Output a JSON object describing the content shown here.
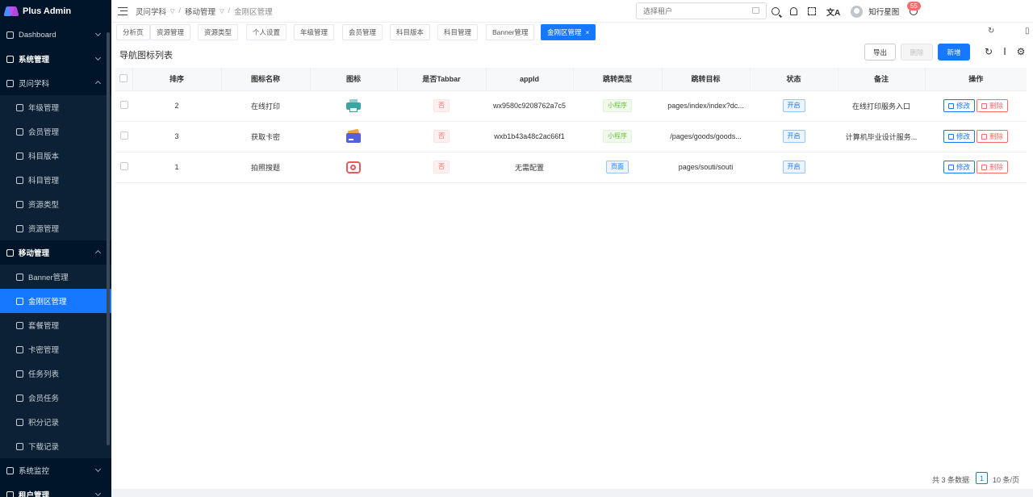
{
  "app": {
    "name": "Plus Admin"
  },
  "sidebar": {
    "items": [
      {
        "label": "Dashboard",
        "type": "top"
      },
      {
        "label": "系统管理",
        "type": "top-bold"
      },
      {
        "label": "灵问学科",
        "type": "top"
      },
      {
        "label": "年级管理",
        "type": "sub"
      },
      {
        "label": "会员管理",
        "type": "sub"
      },
      {
        "label": "科目版本",
        "type": "sub"
      },
      {
        "label": "科目管理",
        "type": "sub"
      },
      {
        "label": "资源类型",
        "type": "sub"
      },
      {
        "label": "资源管理",
        "type": "sub"
      },
      {
        "label": "移动管理",
        "type": "top-bold"
      },
      {
        "label": "Banner管理",
        "type": "sub"
      },
      {
        "label": "金刚区管理",
        "type": "sub-active"
      },
      {
        "label": "套餐管理",
        "type": "sub"
      },
      {
        "label": "卡密管理",
        "type": "sub"
      },
      {
        "label": "任务列表",
        "type": "sub"
      },
      {
        "label": "会员任务",
        "type": "sub"
      },
      {
        "label": "积分记录",
        "type": "sub"
      },
      {
        "label": "下载记录",
        "type": "sub"
      },
      {
        "label": "系统监控",
        "type": "top"
      },
      {
        "label": "租户管理",
        "type": "top-bold"
      }
    ]
  },
  "header": {
    "breadcrumb": [
      "灵问学科",
      "移动管理",
      "金刚区管理"
    ],
    "tenant_placeholder": "选择租户",
    "notification_count": "55",
    "username": "知行星图"
  },
  "tabs": [
    "分析页",
    "资源管理",
    "资源类型",
    "个人设置",
    "年级管理",
    "会员管理",
    "科目版本",
    "科目管理",
    "Banner管理",
    "金刚区管理"
  ],
  "toolbar": {
    "title": "导航图标列表",
    "export": "导出",
    "delete": "删除",
    "add": "新增"
  },
  "table": {
    "headers": [
      "排序",
      "图标名称",
      "图标",
      "是否Tabbar",
      "appId",
      "跳转类型",
      "跳转目标",
      "状态",
      "备注",
      "操作"
    ],
    "rows": [
      {
        "sort": "2",
        "name": "在线打印",
        "icon": "printer",
        "tabbar": "否",
        "appid": "wx9580c9208762a7c5",
        "jump_type": "小程序",
        "jump_style": "mini",
        "target": "pages/index/index?dc...",
        "status": "开启",
        "remark": "在线打印服务入口"
      },
      {
        "sort": "3",
        "name": "获取卡密",
        "icon": "card",
        "tabbar": "否",
        "appid": "wxb1b43a48c2ac66f1",
        "jump_type": "小程序",
        "jump_style": "mini",
        "target": "/pages/goods/goods...",
        "status": "开启",
        "remark": "计算机毕业设计服务..."
      },
      {
        "sort": "1",
        "name": "拍照搜题",
        "icon": "camsearch",
        "tabbar": "否",
        "appid": "无需配置",
        "jump_type": "页面",
        "jump_style": "page",
        "target": "pages/souti/souti",
        "status": "开启",
        "remark": ""
      }
    ],
    "edit_label": "修改",
    "delete_label": "删除"
  },
  "pagination": {
    "total": "共 3 条数据",
    "page": "1",
    "page_size": "10 条/页"
  }
}
